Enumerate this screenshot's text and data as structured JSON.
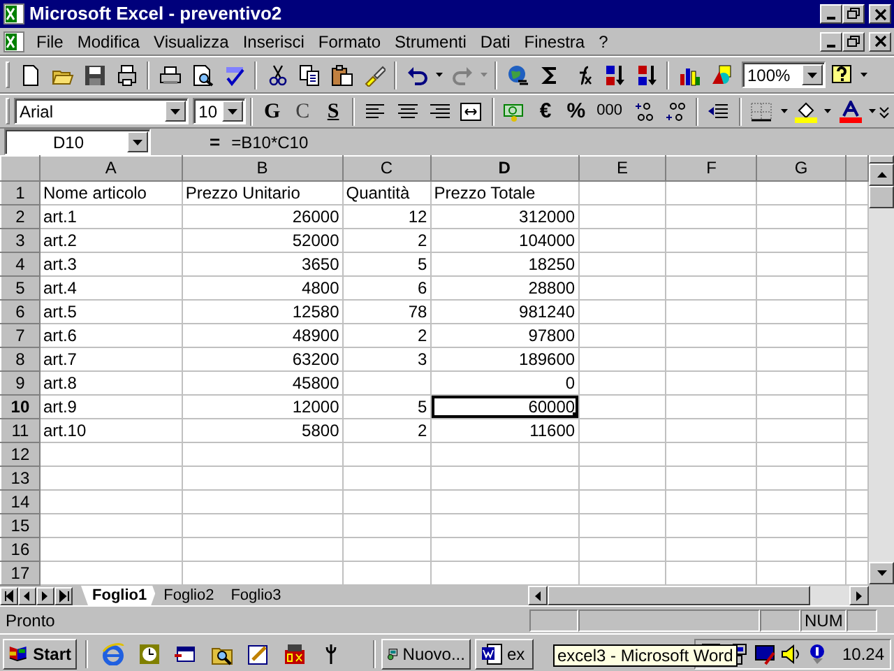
{
  "window": {
    "title": "Microsoft Excel - preventivo2"
  },
  "menu": [
    {
      "label": "File"
    },
    {
      "label": "Modifica"
    },
    {
      "label": "Visualizza"
    },
    {
      "label": "Inserisci"
    },
    {
      "label": "Formato"
    },
    {
      "label": "Strumenti"
    },
    {
      "label": "Dati"
    },
    {
      "label": "Finestra"
    },
    {
      "label": "?"
    }
  ],
  "standard_toolbar": {
    "zoom": "100%"
  },
  "formatting_toolbar": {
    "font": "Arial",
    "size": "10",
    "bold": "G",
    "italic": "C",
    "underline": "S",
    "euro": "€",
    "percent": "%",
    "thousands": "000"
  },
  "formula_bar": {
    "name_box": "D10",
    "equals": "=",
    "formula": "=B10*C10"
  },
  "columns": [
    {
      "label": "A",
      "selected": false
    },
    {
      "label": "B",
      "selected": false
    },
    {
      "label": "C",
      "selected": false
    },
    {
      "label": "D",
      "selected": true
    },
    {
      "label": "E",
      "selected": false
    },
    {
      "label": "F",
      "selected": false
    },
    {
      "label": "G",
      "selected": false
    }
  ],
  "rows": [
    {
      "header": "1",
      "selected": false,
      "kind": "header",
      "cells": [
        "Nome articolo",
        "Prezzo Unitario",
        "Quantità",
        "Prezzo Totale"
      ]
    },
    {
      "header": "2",
      "selected": false,
      "kind": "data",
      "cells": [
        "art.1",
        "26000",
        "12",
        "312000"
      ]
    },
    {
      "header": "3",
      "selected": false,
      "kind": "data",
      "cells": [
        "art.2",
        "52000",
        "2",
        "104000"
      ]
    },
    {
      "header": "4",
      "selected": false,
      "kind": "data",
      "cells": [
        "art.3",
        "3650",
        "5",
        "18250"
      ]
    },
    {
      "header": "5",
      "selected": false,
      "kind": "data",
      "cells": [
        "art.4",
        "4800",
        "6",
        "28800"
      ]
    },
    {
      "header": "6",
      "selected": false,
      "kind": "data",
      "cells": [
        "art.5",
        "12580",
        "78",
        "981240"
      ]
    },
    {
      "header": "7",
      "selected": false,
      "kind": "data",
      "cells": [
        "art.6",
        "48900",
        "2",
        "97800"
      ]
    },
    {
      "header": "8",
      "selected": false,
      "kind": "data",
      "cells": [
        "art.7",
        "63200",
        "3",
        "189600"
      ]
    },
    {
      "header": "9",
      "selected": false,
      "kind": "data",
      "cells": [
        "art.8",
        "45800",
        null,
        "0"
      ]
    },
    {
      "header": "10",
      "selected": true,
      "kind": "data",
      "cells": [
        "art.9",
        "12000",
        "5",
        "60000"
      ]
    },
    {
      "header": "11",
      "selected": false,
      "kind": "data",
      "cells": [
        "art.10",
        "5800",
        "2",
        "11600"
      ]
    },
    {
      "header": "12",
      "selected": false,
      "kind": "empty"
    },
    {
      "header": "13",
      "selected": false,
      "kind": "empty"
    },
    {
      "header": "14",
      "selected": false,
      "kind": "empty"
    },
    {
      "header": "15",
      "selected": false,
      "kind": "empty"
    },
    {
      "header": "16",
      "selected": false,
      "kind": "empty"
    },
    {
      "header": "17",
      "selected": false,
      "kind": "empty"
    }
  ],
  "sheet_tabs": [
    {
      "label": "Foglio1",
      "selected": true
    },
    {
      "label": "Foglio2",
      "selected": false
    },
    {
      "label": "Foglio3",
      "selected": false
    }
  ],
  "status_bar": {
    "message": "Pronto",
    "indicators": [
      "NUM"
    ]
  },
  "taskbar": {
    "start": "Start",
    "tasks": [
      {
        "label": "Nuovo...",
        "kind": "dialup"
      },
      {
        "label": "ex",
        "kind": "word"
      }
    ],
    "tooltip": "excel3 - Microsoft Word",
    "clock": "10.24"
  }
}
